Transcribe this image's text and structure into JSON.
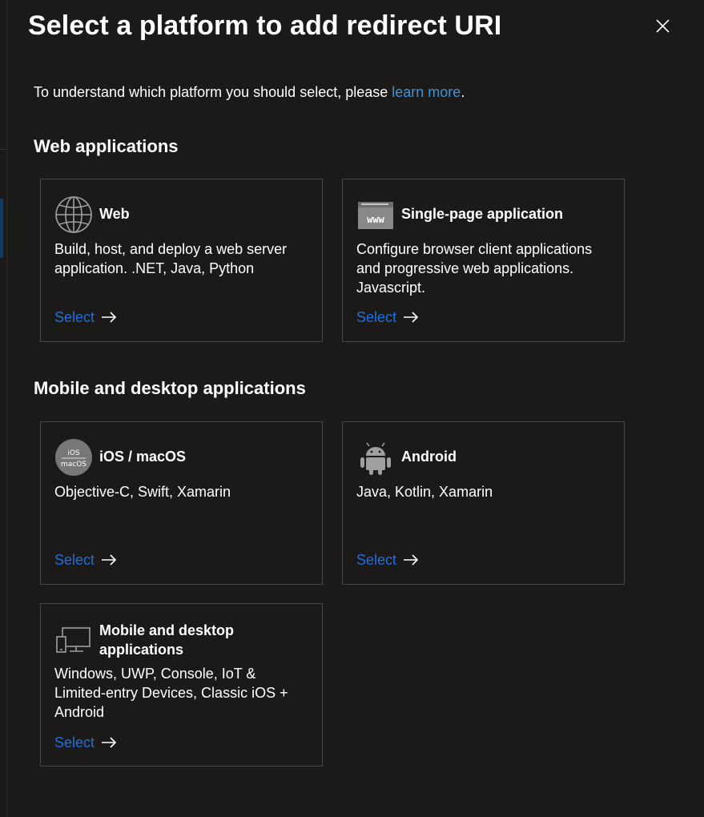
{
  "dialog": {
    "title": "Select a platform to add redirect URI",
    "intro_text": "To understand which platform you should select, please ",
    "intro_link": "learn more",
    "intro_suffix": "."
  },
  "sections": {
    "web": {
      "title": "Web applications"
    },
    "mobile": {
      "title": "Mobile and desktop applications"
    }
  },
  "cards": {
    "web": {
      "title": "Web",
      "description": "Build, host, and deploy a web server application. .NET, Java, Python",
      "action": "Select",
      "icon": "globe-icon"
    },
    "spa": {
      "title": "Single-page application",
      "description": "Configure browser client applications and progressive web applications. Javascript.",
      "action": "Select",
      "icon": "browser-www-icon",
      "icon_text": "www"
    },
    "ios": {
      "title": "iOS / macOS",
      "description": "Objective-C, Swift, Xamarin",
      "action": "Select",
      "icon": "ios-macos-icon",
      "icon_text_top": "iOS",
      "icon_text_bottom": "macOS"
    },
    "android": {
      "title": "Android",
      "description": "Java, Kotlin, Xamarin",
      "action": "Select",
      "icon": "android-icon"
    },
    "desktop": {
      "title": "Mobile and desktop applications",
      "description": "Windows, UWP, Console, IoT & Limited-entry Devices, Classic iOS + Android",
      "action": "Select",
      "icon": "desktop-mobile-icon"
    }
  },
  "colors": {
    "background": "#1b1a19",
    "card_border": "#484644",
    "link": "#3a96dd",
    "select": "#1f6fdf",
    "text": "#ffffff"
  }
}
